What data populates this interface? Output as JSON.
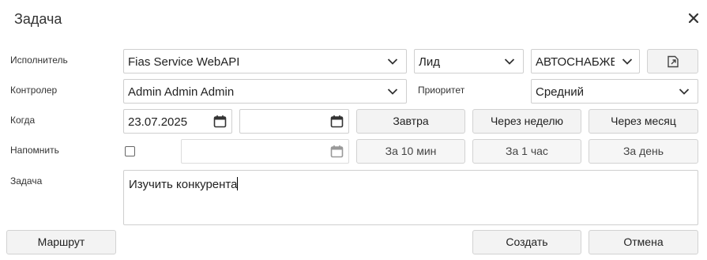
{
  "dialog": {
    "title": "Задача"
  },
  "labels": {
    "executor": "Исполнитель",
    "controller": "Контролер",
    "priority": "Приоритет",
    "when": "Когда",
    "remind": "Напомнить",
    "task": "Задача"
  },
  "fields": {
    "executor": "Fias Service WebAPI",
    "type": "Лид",
    "company": "АВТОСНАБЖЕ",
    "controller": "Admin Admin Admin",
    "priority": "Средний",
    "date_from": "23.07.2025",
    "date_to": "",
    "remind_date": "",
    "remind_checked": false,
    "task_text": "Изучить конкурента"
  },
  "buttons": {
    "tomorrow": "Завтра",
    "next_week": "Через неделю",
    "next_month": "Через месяц",
    "in_10_min": "За 10 мин",
    "in_1_hour": "За 1 час",
    "in_1_day": "За день",
    "route": "Маршрут",
    "create": "Создать",
    "cancel": "Отмена"
  },
  "icons": {
    "close": "close-icon",
    "dropdown": "chevron-down-icon",
    "calendar": "calendar-icon",
    "open_card": "open-card-icon"
  }
}
